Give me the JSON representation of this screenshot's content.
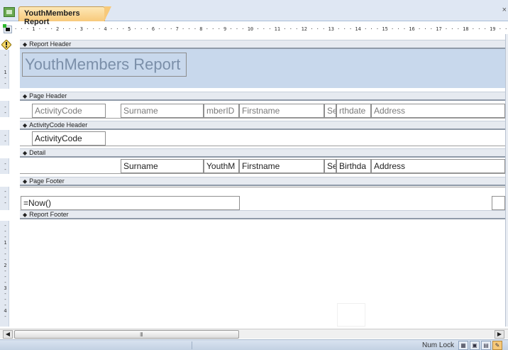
{
  "tab": {
    "title": "YouthMembers Report",
    "close": "×"
  },
  "ruler": {
    "horizontal": "· · · 1 · · · 2 · · · 3 · · · 4 · · · 5 · · · 6 · · · 7 · · · 8 · · · 9 · · · 10 · · · 11 · · · 12 · · · 13 · · · 14 · · · 15 · · · 16 · · · 17 · · · 18 · · · 19 · · ·",
    "v_report_header": "-\n\n-\n1\n-\n-",
    "v_page_header": "-\n-",
    "v_group_header": "-\n-",
    "v_detail": "-\n-",
    "v_page_footer": "-\n-\n-",
    "v_report_footer": "-\n-\n-\n1\n-\n-\n-\n2\n-\n-\n-\n3\n-\n-\n-\n4\n-"
  },
  "sections": {
    "report_header": "Report Header",
    "page_header": "Page Header",
    "group_header": "ActivityCode Header",
    "detail": "Detail",
    "page_footer": "Page Footer",
    "report_footer": "Report Footer"
  },
  "report_title": "YouthMembers Report",
  "page_header_labels": {
    "activity_code": "ActivityCode",
    "surname": "Surname",
    "member_id": "mberID",
    "firstname": "Firstname",
    "sex": "Se",
    "birthdate": "rthdate",
    "address": "Address"
  },
  "group_header_field": "ActivityCode",
  "detail_fields": {
    "surname": "Surname",
    "youth_m": "YouthM",
    "firstname": "Firstname",
    "sex": "Se",
    "birthdate": "Birthda",
    "address": "Address"
  },
  "page_footer_field": "=Now()",
  "hscroll": {
    "left": "◀",
    "right": "▶",
    "grip": "III"
  },
  "status": {
    "num_lock": "Num Lock",
    "view_buttons": [
      "▦",
      "▣",
      "▤",
      "✎"
    ]
  }
}
